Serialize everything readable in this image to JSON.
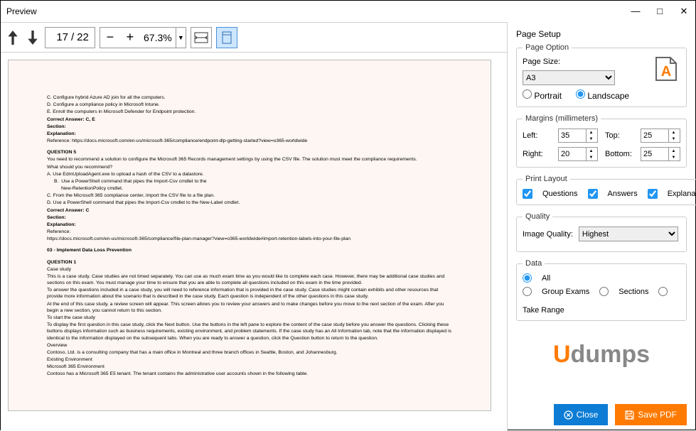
{
  "window": {
    "title": "Preview"
  },
  "toolbar": {
    "current_page": "17",
    "total_pages": "22",
    "zoom": "67.3%"
  },
  "doc": {
    "c": "C.  Configure hybrid Azure AD join for all the computers.",
    "d": "D.  Configure a compliance policy in Microsoft Intune.",
    "e": "E.  Enroll the computers in Microsoft Defender for Endpoint protection.",
    "ans_ce": "Correct Answer: C, E",
    "section": "Section:",
    "explain": "Explanation:",
    "ref1": "Reference: https://docs.microsoft.com/en-us/microsoft-365/compliance/endpoint-dlp-getting-started?view=o365-worldwide",
    "q5": "QUESTION 5",
    "q5_1": "You need to recommend a solution to configure the Microsoft 365 Records management settings by using the CSV file. The solution must meet the compliance requirements.",
    "q5_2": "What should you recommend?",
    "q5_a": "A.  Use EdmUploadAgent.exe to upload a hash of the CSV to a datastore.",
    "q5_b1": "Use a PowerShell command that pipes the Import-Csv cmdlet to the",
    "q5_b2": "New-RetentionPolicy cmdlet.",
    "q5_c": "C.  From the Microsoft 365 compliance center, import the CSV file to a file plan.",
    "q5_d": "D.  Use a PowerShell command that pipes the Import-Csv cmdlet to the New-Label cmdlet.",
    "ans_c": "Correct Answer: C",
    "ref2_1": "Reference:",
    "ref2_2": "https://docs.microsoft.com/en-us/microsoft-365/compliance/file-plan-manager?view=o365-worldwide#import-retention-labels-into-your-file-plan",
    "topic": "03 - Implement Data Loss Prevention",
    "q1": "QUESTION 1",
    "case": "Case study",
    "p1": "This is a case study. Case studies are not timed separately. You can use as much exam time as you would like to complete each case. However, there may be additional case studies and sections on this exam. You must manage your time to ensure that you are able to complete all questions included on this exam in the time provided.",
    "p2": "To answer the questions included in a case study, you will need to reference information that is provided in the case study. Case studies might contain exhibits and other resources that provide more information about the scenario that is described in the case study. Each question is independent of the other questions in this case study.",
    "p3": "At the end of this case study, a review screen will appear. This screen allows you to review your answers and to make changes before you move to the next section of the exam. After you begin a new section, you cannot return to this section.",
    "start": "To start the case study",
    "p4": "To display the first question in this case study, click the Next button. Use the buttons in the left pane to explore the content of the case study before you answer the questions. Clicking these buttons displays information such as business requirements, existing environment, and problem statements. If the case study has an All Information tab, note that the information displayed is identical to the information displayed on the subsequent tabs. When you are ready to answer a question, click the Question button to return to the question.",
    "ov": "Overview",
    "ov1": "Contoso, Ltd. is a consulting company that has a main office in Montreal and three branch offices in Seattle, Boston, and Johannesburg.",
    "env": "Existing Environment",
    "env1": "Microsoft 365 Environment",
    "env2": "Contoso has a Microsoft 365 E5 tenant. The tenant contains the administrative user accounts shown in the following table."
  },
  "panel": {
    "title": "Page Setup",
    "page_option_legend": "Page Option",
    "page_size_label": "Page Size:",
    "page_size_value": "A3",
    "portrait": "Portrait",
    "landscape": "Landscape",
    "margins_legend": "Margins (millimeters)",
    "left_label": "Left:",
    "left_value": "35",
    "top_label": "Top:",
    "top_value": "25",
    "right_label": "Right:",
    "right_value": "20",
    "bottom_label": "Bottom:",
    "bottom_value": "25",
    "layout_legend": "Print Layout",
    "questions": "Questions",
    "answers": "Answers",
    "explanation": "Explanation",
    "quality_legend": "Quality",
    "image_quality_label": "Image Quality:",
    "image_quality_value": "Highest",
    "data_legend": "Data",
    "all": "All",
    "group_exams": "Group Exams",
    "sections": "Sections",
    "take_range": "Take Range",
    "close_btn": "Close",
    "save_btn": "Save PDF"
  },
  "logo": {
    "u": "U",
    "rest": "dumps"
  }
}
